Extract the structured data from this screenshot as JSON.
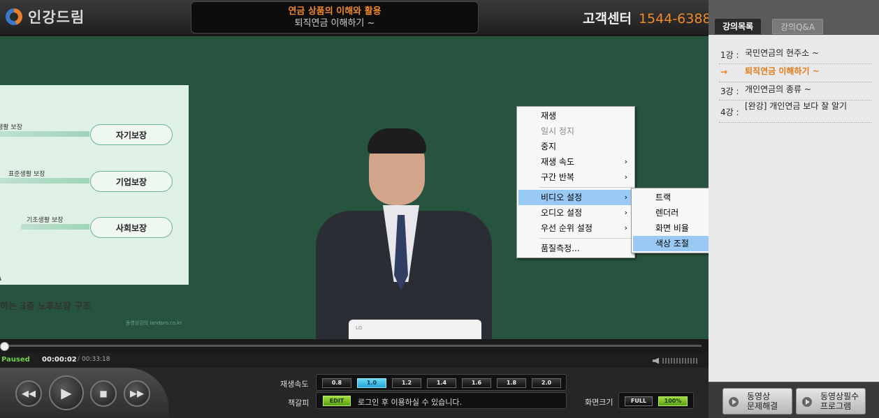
{
  "header": {
    "logo_text": "인강드림",
    "title_main": "연금 상품의 이해와 활용",
    "title_sub": "퇴직연금 이해하기 ~",
    "support_label": "고객센터",
    "support_number": "1544-6388"
  },
  "slide": {
    "rows": [
      {
        "label": "생활 보장",
        "pill": "자기보장"
      },
      {
        "label": "표준생활 보장",
        "pill": "기업보장"
      },
      {
        "label": "기초생활 보장",
        "pill": "사회보장"
      }
    ],
    "caption": "하는 3층 노후보장 구조",
    "watermark": "동영상강의 landpro.co.kr"
  },
  "laptop_brand": "LG",
  "context_menu": {
    "items": [
      {
        "label": "재생"
      },
      {
        "label": "일시 정지"
      },
      {
        "label": "중지"
      },
      {
        "label": "재생 속도"
      },
      {
        "label": "구간 반복"
      },
      {
        "label": "비디오 설정"
      },
      {
        "label": "오디오 설정"
      },
      {
        "label": "우선 순위 설정"
      },
      {
        "label": "품질측정..."
      }
    ],
    "submenu": [
      {
        "label": "트랙"
      },
      {
        "label": "렌더러"
      },
      {
        "label": "화면 비율"
      },
      {
        "label": "색상 조절"
      }
    ],
    "arrow": "›"
  },
  "player": {
    "state": "Paused",
    "time_current": "00:00:02",
    "time_sep": "/",
    "time_total": "00:33:18",
    "progress": 0.001,
    "speed_label": "재생속도",
    "speeds": [
      "0.8",
      "1.0",
      "1.2",
      "1.4",
      "1.6",
      "1.8",
      "2.0"
    ],
    "speed_selected": "1.0",
    "bookmark_label": "책갈피",
    "edit_label": "EDIT",
    "bookmark_text": "로그인 후 이용하실 수 있습니다.",
    "screen_label": "화면크기",
    "full_label": "FULL",
    "pct_label": "100%"
  },
  "sidebar": {
    "tabs": [
      "강의목록",
      "강의Q&A"
    ],
    "lectures": [
      {
        "no": "1강 :",
        "title": "국민연금의 현주소 ~"
      },
      {
        "no": "→",
        "title": "퇴직연금 이해하기 ~"
      },
      {
        "no": "3강 :",
        "title": "개인연금의 종류 ~"
      },
      {
        "no": "4강 :",
        "title": "[완강] 개인연금 보다 잘 알기"
      }
    ],
    "buttons": [
      {
        "l1": "동영상",
        "l2": "문제해결"
      },
      {
        "l1": "동영상필수",
        "l2": "프로그램"
      }
    ]
  },
  "colors": {
    "accent": "#f08a2a",
    "play_state": "#6fcf4a",
    "menu_highlight": "#99c9f5",
    "video_bg": "#27543e"
  }
}
